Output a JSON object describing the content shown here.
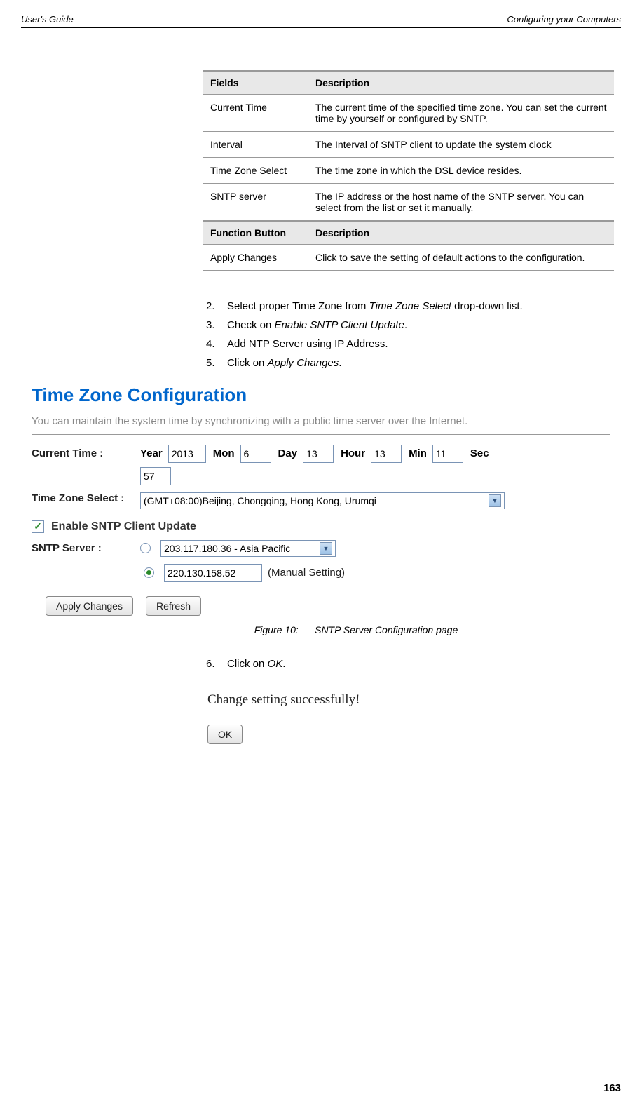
{
  "header": {
    "left": "User's Guide",
    "right": "Configuring your Computers"
  },
  "table": {
    "h1": "Fields",
    "h2": "Description",
    "rows": [
      {
        "f": "Current Time",
        "d": "The current time of the specified time zone. You can set the current time by yourself or configured by SNTP."
      },
      {
        "f": "Interval",
        "d": "The Interval of SNTP client to update the system clock"
      },
      {
        "f": "Time Zone Select",
        "d": "The time zone in which the DSL device resides."
      },
      {
        "f": "SNTP server",
        "d": "The IP address or the host name of the SNTP server. You can select from the list or set it manually."
      }
    ],
    "h3": "Function Button",
    "h4": "Description",
    "rows2": [
      {
        "f": "Apply Changes",
        "d": "Click to save the setting of default actions to the configuration."
      }
    ]
  },
  "steps": {
    "s2": {
      "num": "2.",
      "pre": "Select proper Time Zone from ",
      "em": "Time Zone Select",
      "post": " drop-down list."
    },
    "s3": {
      "num": "3.",
      "pre": "Check on ",
      "em": "Enable SNTP Client Update",
      "post": "."
    },
    "s4": {
      "num": "4.",
      "text": "Add NTP Server using IP Address."
    },
    "s5": {
      "num": "5.",
      "pre": "Click on ",
      "em": "Apply Changes",
      "post": "."
    },
    "s6": {
      "num": "6.",
      "pre": "Click on ",
      "em": "OK",
      "post": "."
    }
  },
  "config": {
    "title": "Time Zone Configuration",
    "desc": "You can maintain the system time by synchronizing with a public time server over the Internet.",
    "currentTimeLabel": "Current Time :",
    "yearLabel": "Year",
    "year": "2013",
    "monLabel": "Mon",
    "mon": "6",
    "dayLabel": "Day",
    "day": "13",
    "hourLabel": "Hour",
    "hour": "13",
    "minLabel": "Min",
    "min": "11",
    "secLabel": "Sec",
    "sec": "57",
    "tzLabel": "Time Zone Select :",
    "tzValue": "(GMT+08:00)Beijing, Chongqing, Hong Kong, Urumqi",
    "enableLabel": "Enable SNTP Client Update",
    "sntpLabel": "SNTP Server :",
    "sntpOption": "203.117.180.36 - Asia Pacific",
    "sntpManual": "220.130.158.52",
    "manualText": "(Manual Setting)",
    "applyBtn": "Apply Changes",
    "refreshBtn": "Refresh"
  },
  "figure": {
    "label": "Figure 10:",
    "caption": "SNTP Server Configuration page"
  },
  "ok": {
    "success": "Change setting successfully!",
    "btn": "OK"
  },
  "pageNum": "163"
}
